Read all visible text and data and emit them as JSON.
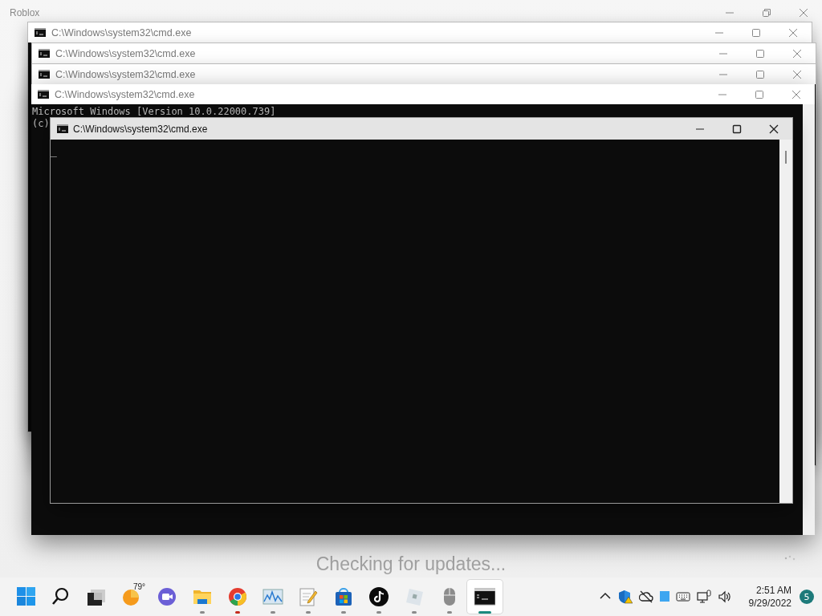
{
  "background_window": {
    "title": "Roblox",
    "maximized": true,
    "status": "Checking for updates..."
  },
  "console_windows": [
    {
      "title": "C:\\Windows\\system32\\cmd.exe"
    },
    {
      "title": "C:\\Windows\\system32\\cmd.exe"
    },
    {
      "title": "C:\\Windows\\system32\\cmd.exe"
    },
    {
      "title": "C:\\Windows\\system32\\cmd.exe",
      "lines": [
        "Microsoft Windows [Version 10.0.22000.739]",
        "(c)"
      ]
    }
  ],
  "front_window": {
    "title": "C:\\Windows\\system32\\cmd.exe",
    "maximized": false,
    "cursor": "_"
  },
  "taskbar": {
    "apps": [
      {
        "kind": "start",
        "running": false,
        "flashing": false,
        "selected": false
      },
      {
        "kind": "search",
        "running": false,
        "flashing": false,
        "selected": false
      },
      {
        "kind": "taskview",
        "running": false,
        "flashing": false,
        "selected": false
      },
      {
        "kind": "weather",
        "label": "79°",
        "running": false,
        "flashing": false,
        "selected": false
      },
      {
        "kind": "chat",
        "running": false,
        "flashing": false,
        "selected": false
      },
      {
        "kind": "folder",
        "running": true,
        "flashing": false,
        "selected": false
      },
      {
        "kind": "browser",
        "running": true,
        "flashing": true,
        "selected": false
      },
      {
        "kind": "monitor",
        "running": true,
        "flashing": false,
        "selected": false
      },
      {
        "kind": "notepad",
        "running": true,
        "flashing": false,
        "selected": false
      },
      {
        "kind": "store",
        "running": true,
        "flashing": false,
        "selected": false
      },
      {
        "kind": "music",
        "running": true,
        "flashing": false,
        "selected": false
      },
      {
        "kind": "game",
        "running": true,
        "flashing": false,
        "selected": false
      },
      {
        "kind": "mouse",
        "running": true,
        "flashing": false,
        "selected": false
      },
      {
        "kind": "console",
        "running": true,
        "flashing": false,
        "selected": true
      }
    ],
    "tray": [
      {
        "kind": "chevron"
      },
      {
        "kind": "shield"
      },
      {
        "kind": "cloud"
      },
      {
        "kind": "square"
      },
      {
        "kind": "keyboard"
      },
      {
        "kind": "network"
      },
      {
        "kind": "volume"
      }
    ],
    "clock": {
      "time": "2:51 AM",
      "date": "9/29/2022"
    },
    "notification_count": "5"
  }
}
